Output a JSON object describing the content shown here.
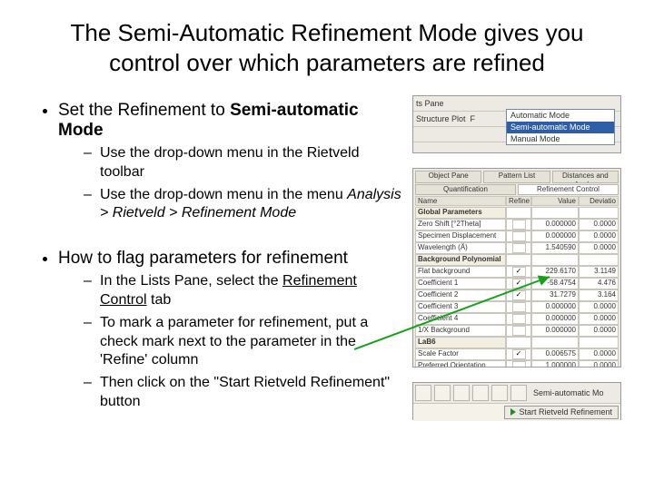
{
  "title": "The Semi-Automatic Refinement Mode gives you control over which parameters are refined",
  "body": {
    "b1": "Set the Refinement to ",
    "b1_bold": "Semi-automatic Mode",
    "b1s1": "Use the drop-down menu in the Rietveld toolbar",
    "b1s2_a": "Use the drop-down menu in the menu ",
    "b1s2_i": "Analysis > Rietveld > Refinement Mode",
    "b2": "How to flag parameters for refinement",
    "b2s1_a": "In the Lists Pane, select the ",
    "b2s1_u": "Refinement Control",
    "b2s1_b": " tab",
    "b2s2": "To mark a parameter for refinement, put a check mark next to the parameter in the 'Refine' column",
    "b2s3": "Then click on the \"Start Rietveld Refinement\" button"
  },
  "shot1": {
    "pane": "ts Pane",
    "row2a": "Structure Plot",
    "row2b": "F",
    "opt1": "Automatic Mode",
    "opt2": "Semi-automatic Mode",
    "opt3": "Manual Mode"
  },
  "shot2": {
    "tab1": "Object Pane",
    "tab2": "Pattern List",
    "tab3": "Distances and Angles",
    "tab4": "Quantification",
    "tab5": "Refinement Control",
    "h1": "Name",
    "h2": "Refine",
    "h3": "Value",
    "h4": "Deviatio",
    "rows": [
      {
        "n": "Global Parameters",
        "g": true
      },
      {
        "n": "  Zero Shift [°2Theta]",
        "r": false,
        "v": "0.000000",
        "d": "0.0000"
      },
      {
        "n": "  Specimen Displacement",
        "r": false,
        "v": "0.000000",
        "d": "0.0000"
      },
      {
        "n": "  Wavelength (Å)",
        "r": false,
        "v": "1.540590",
        "d": "0.0000"
      },
      {
        "n": "Background Polynomial",
        "g": true
      },
      {
        "n": "  Flat background",
        "r": true,
        "v": "229.6170",
        "d": "3.1149"
      },
      {
        "n": "  Coefficient 1",
        "r": true,
        "v": "-58.4754",
        "d": "4.476"
      },
      {
        "n": "  Coefficient 2",
        "r": true,
        "v": "31.7279",
        "d": "3.164"
      },
      {
        "n": "  Coefficient 3",
        "r": false,
        "v": "0.000000",
        "d": "0.0000"
      },
      {
        "n": "  Coefficient 4",
        "r": false,
        "v": "0.000000",
        "d": "0.0000"
      },
      {
        "n": "  1/X Background",
        "r": false,
        "v": "0.000000",
        "d": "0.0000"
      },
      {
        "n": "LaB6",
        "g": true
      },
      {
        "n": "  Scale Factor",
        "r": true,
        "v": "0.006575",
        "d": "0.0000"
      },
      {
        "n": "  Preferred Orientation",
        "r": false,
        "v": "1.000000",
        "d": "0.0000"
      }
    ]
  },
  "shot3": {
    "mode": "Semi-automatic Mo",
    "btn": "Start Rietveld Refinement"
  }
}
